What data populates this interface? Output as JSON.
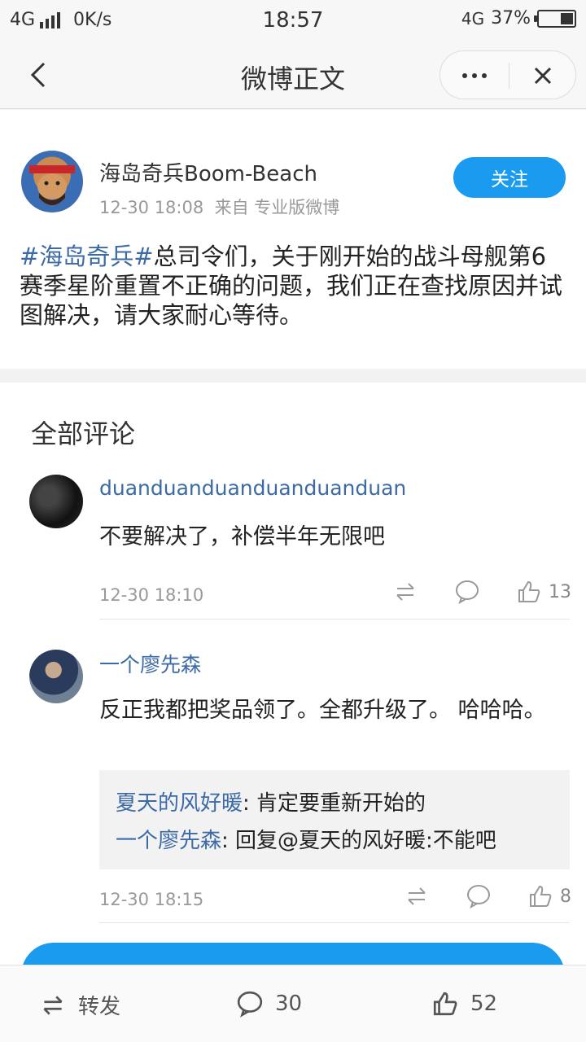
{
  "status_bar": {
    "network": "4G",
    "speed": "0K/s",
    "time": "18:57",
    "network_right": "4G",
    "battery": "37%",
    "battery_level": 0.37
  },
  "nav": {
    "title": "微博正文",
    "back_icon": "chevron-left-icon",
    "more_icon": "more-dots-icon",
    "close_icon": "close-icon"
  },
  "post": {
    "author": "海岛奇兵Boom-Beach",
    "time": "12-30 18:08",
    "source": "来自 专业版微博",
    "follow_label": "关注",
    "hashtag": "#海岛奇兵#",
    "body": "总司令们，关于刚开始的战斗母舰第6赛季星阶重置不正确的问题，我们正在查找原因并试图解决，请大家耐心等待。"
  },
  "comments": {
    "title": "全部评论",
    "items": [
      {
        "name": "duanduanduanduanduanduan",
        "text": "不要解决了，补偿半年无限吧",
        "time": "12-30 18:10",
        "likes": "13"
      },
      {
        "name": "一个廖先森",
        "text": "反正我都把奖品领了。全都升级了。 哈哈哈。",
        "time": "12-30 18:15",
        "likes": "8",
        "replies": [
          {
            "who": "夏天的风好暖",
            "text": ": 肯定要重新开始的"
          },
          {
            "who": "一个廖先森",
            "text": ": 回复@夏天的风好暖:不能吧"
          }
        ]
      }
    ]
  },
  "bottom_bar": {
    "repost_label": "转发",
    "comment_count": "30",
    "like_count": "52"
  },
  "colors": {
    "accent": "#1a9bf0",
    "link": "#3c6aa6"
  }
}
